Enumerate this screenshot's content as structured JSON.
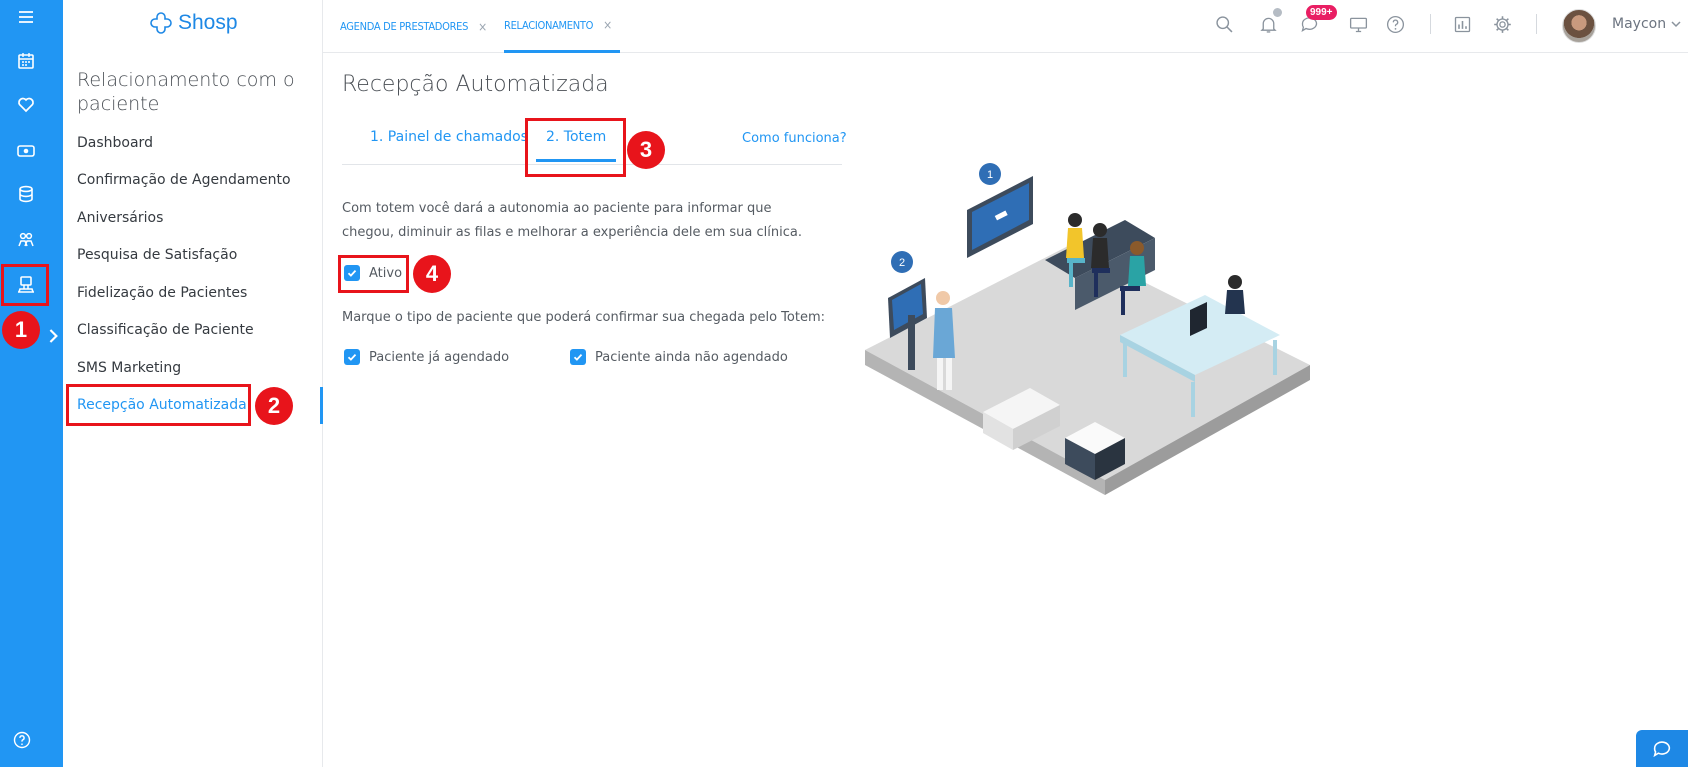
{
  "brand": {
    "name": "Shosp",
    "accent": "#2196f3",
    "highlight": "#e8141b"
  },
  "rail": {
    "icons": [
      "menu-icon",
      "calendar-icon",
      "heart-icon",
      "money-icon",
      "database-icon",
      "group-icon",
      "reception-icon"
    ],
    "bottom_icon": "help-icon"
  },
  "sidebar": {
    "title": "Relacionamento com o paciente",
    "items": [
      {
        "label": "Dashboard",
        "active": false
      },
      {
        "label": "Confirmação de Agendamento",
        "active": false
      },
      {
        "label": "Aniversários",
        "active": false
      },
      {
        "label": "Pesquisa de Satisfação",
        "active": false
      },
      {
        "label": "Fidelização de Pacientes",
        "active": false
      },
      {
        "label": "Classificação de Paciente",
        "active": false
      },
      {
        "label": "SMS Marketing",
        "active": false
      },
      {
        "label": "Recepção Automatizada",
        "active": true
      }
    ]
  },
  "topbar": {
    "tabs": [
      {
        "label": "AGENDA DE PRESTADORES",
        "close": "×",
        "active": false
      },
      {
        "label": "RELACIONAMENTO",
        "close": "×",
        "active": true
      }
    ],
    "messages_badge": "999+",
    "user_name": "Maycon"
  },
  "main": {
    "title": "Recepção Automatizada",
    "subtabs": [
      {
        "label": "1. Painel de chamados",
        "active": false
      },
      {
        "label": "2. Totem",
        "active": true
      }
    ],
    "help_link": "Como funciona?",
    "description": "Com totem você dará a autonomia ao paciente para informar que chegou, diminuir as filas e melhorar a experiência dele em sua clínica.",
    "active_checkbox": {
      "label": "Ativo",
      "checked": true
    },
    "patient_type_prompt": "Marque o tipo de paciente que poderá confirmar sua chegada pelo Totem:",
    "patient_types": [
      {
        "label": "Paciente já agendado",
        "checked": true
      },
      {
        "label": "Paciente ainda não agendado",
        "checked": true
      }
    ]
  },
  "illustration": {
    "markers": [
      "1",
      "2"
    ]
  },
  "annotations": [
    "1",
    "2",
    "3",
    "4"
  ]
}
